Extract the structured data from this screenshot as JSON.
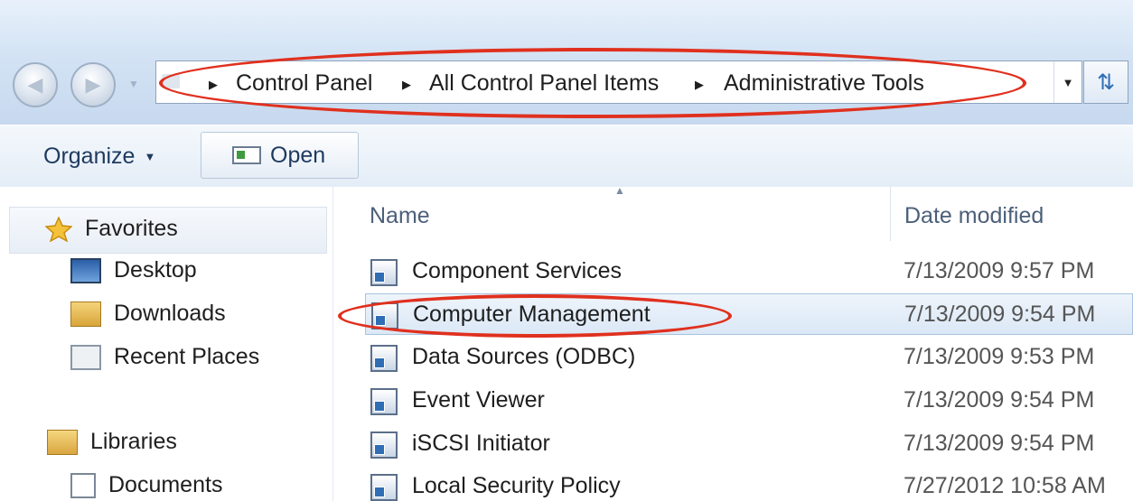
{
  "address_bar": {
    "crumbs": [
      "Control Panel",
      "All Control Panel Items",
      "Administrative Tools"
    ]
  },
  "toolbar": {
    "organize_label": "Organize",
    "open_label": "Open"
  },
  "navigation": {
    "favorites_label": "Favorites",
    "items": [
      "Desktop",
      "Downloads",
      "Recent Places"
    ],
    "libraries_label": "Libraries",
    "library_items": [
      "Documents"
    ]
  },
  "file_list": {
    "columns": {
      "name": "Name",
      "date_modified": "Date modified"
    },
    "rows": [
      {
        "name": "Component Services",
        "date": "7/13/2009 9:57 PM"
      },
      {
        "name": "Computer Management",
        "date": "7/13/2009 9:54 PM",
        "selected": true
      },
      {
        "name": "Data Sources (ODBC)",
        "date": "7/13/2009 9:53 PM"
      },
      {
        "name": "Event Viewer",
        "date": "7/13/2009 9:54 PM"
      },
      {
        "name": "iSCSI Initiator",
        "date": "7/13/2009 9:54 PM"
      },
      {
        "name": "Local Security Policy",
        "date": "7/27/2012 10:58 AM"
      }
    ]
  },
  "colors": {
    "highlight_ellipse": "#e0301e",
    "selection": "#dbe8f6"
  }
}
